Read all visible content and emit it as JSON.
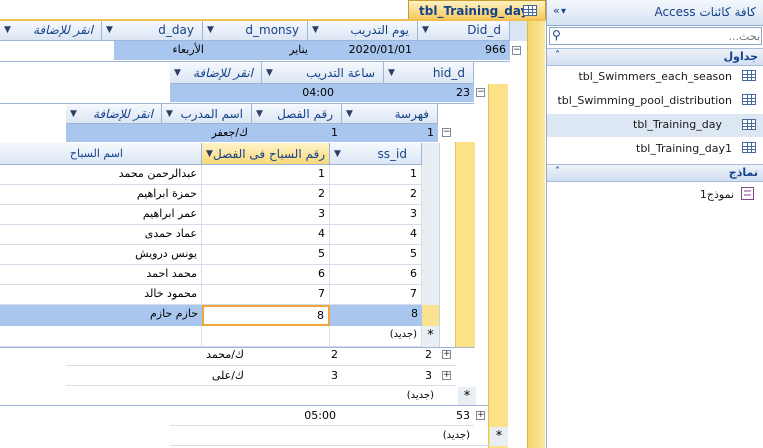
{
  "document_tab": {
    "title": "tbl_Training_day"
  },
  "level1": {
    "headers": [
      "Did_d",
      "يوم التدريب",
      "d_monsy",
      "d_day",
      "انقر للإضافة"
    ],
    "row": {
      "id": "966",
      "date": "2020/01/01",
      "month": "يناير",
      "day": "الأربعاء"
    }
  },
  "level2": {
    "headers": [
      "hid_d",
      "ساعة التدريب",
      "انقر للإضافة"
    ],
    "row": {
      "id": "23",
      "hour": "04:00"
    }
  },
  "level3": {
    "headers": [
      "فهرسة",
      "رقم الفصل",
      "اسم المدرب",
      "انقر للإضافة"
    ],
    "row": {
      "index": "1",
      "class": "1",
      "coach": "ك/جعفر"
    }
  },
  "level4": {
    "headers": [
      "ss_id",
      "رقم السباح فى الفصل",
      "اسم السباح"
    ],
    "rows": [
      {
        "ss_id": "1",
        "num": "1",
        "name": "عبدالرحمن محمد"
      },
      {
        "ss_id": "2",
        "num": "2",
        "name": "حمزة ابراهيم"
      },
      {
        "ss_id": "3",
        "num": "3",
        "name": "عمر ابراهيم"
      },
      {
        "ss_id": "4",
        "num": "4",
        "name": "عماد حمدى"
      },
      {
        "ss_id": "5",
        "num": "5",
        "name": "يونس درويش"
      },
      {
        "ss_id": "6",
        "num": "6",
        "name": "محمد احمد"
      },
      {
        "ss_id": "7",
        "num": "7",
        "name": "محمود خالد"
      },
      {
        "ss_id": "8",
        "num": "8",
        "name": "حازم حازم"
      }
    ],
    "new_label": "(جديد)"
  },
  "level3_more": [
    {
      "index": "2",
      "class": "2",
      "coach": "ك/محمد"
    },
    {
      "index": "3",
      "class": "3",
      "coach": "ك/على"
    }
  ],
  "level3_new": "(جديد)",
  "level2_more": {
    "id": "53",
    "hour": "05:00"
  },
  "level2_new": "(جديد)",
  "nav": {
    "title": "كافة كائنات Access",
    "search_placeholder": "بحث...",
    "group_tables": "جداول",
    "tables": [
      "tbl_Swimmers_each_season",
      "tbl_Swimming_pool_distribution",
      "tbl_Training_day",
      "tbl_Training_day1"
    ],
    "group_forms": "نماذج",
    "forms": [
      "نموذج1"
    ]
  }
}
